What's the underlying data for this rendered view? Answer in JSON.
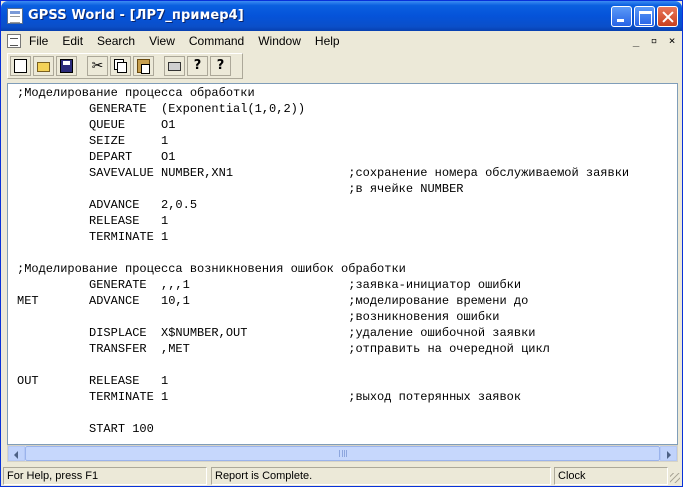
{
  "window": {
    "title": "GPSS World - [ЛР7_пример4]"
  },
  "menubar": {
    "items": [
      "File",
      "Edit",
      "Search",
      "View",
      "Command",
      "Window",
      "Help"
    ]
  },
  "toolbar": {
    "icons": [
      "new-icon",
      "open-icon",
      "save-icon",
      "cut-icon",
      "copy-icon",
      "paste-icon",
      "print-icon",
      "help-icon",
      "whats-this-icon"
    ],
    "help_glyph": "?",
    "whatsthis_glyph": "?",
    "cut_glyph": "✂"
  },
  "editor": {
    "lines": [
      ";Моделирование процесса обработки",
      "          GENERATE  (Exponential(1,0,2))",
      "          QUEUE     O1",
      "          SEIZE     1",
      "          DEPART    O1",
      "          SAVEVALUE NUMBER,XN1                ;сохранение номера обслуживаемой заявки",
      "                                              ;в ячейке NUMBER",
      "          ADVANCE   2,0.5",
      "          RELEASE   1",
      "          TERMINATE 1",
      "",
      ";Моделирование процесса возникновения ошибок обработки",
      "          GENERATE  ,,,1                      ;заявка-инициатор ошибки",
      "MET       ADVANCE   10,1                      ;моделирование времени до",
      "                                              ;возникновения ошибки",
      "          DISPLACE  X$NUMBER,OUT              ;удаление ошибочной заявки",
      "          TRANSFER  ,MET                      ;отправить на очередной цикл",
      "",
      "OUT       RELEASE   1",
      "          TERMINATE 1                         ;выход потерянных заявок",
      "",
      "          START 100"
    ]
  },
  "statusbar": {
    "help_text": "For Help, press F1",
    "report_text": "Report is Complete.",
    "clock_label": "Clock"
  }
}
